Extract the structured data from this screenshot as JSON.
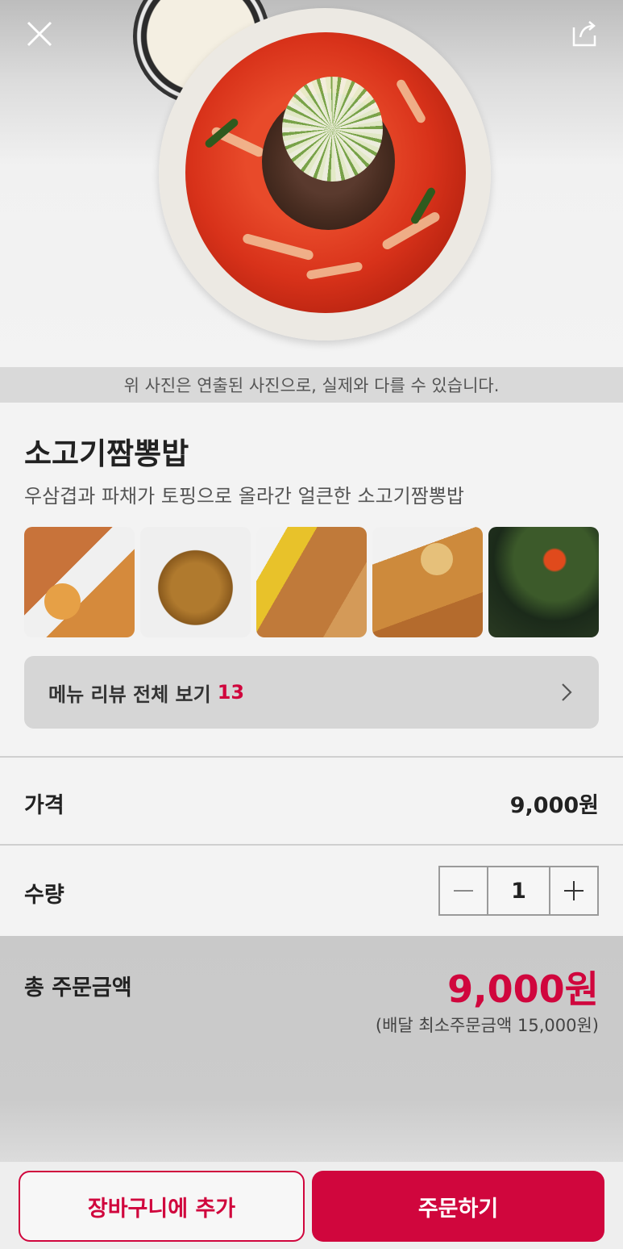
{
  "hero": {
    "image_icon": "food-photo",
    "close_icon": "close-icon",
    "share_icon": "share-icon",
    "disclaimer": "위 사진은 연출된 사진으로, 실제와 다를 수 있습니다."
  },
  "menu": {
    "title": "소고기짬뽕밥",
    "description": "우삼겹과 파채가 토핑으로 올라간 얼큰한 소고기짬뽕밥"
  },
  "review_photos": [
    "review-photo-1",
    "review-photo-2",
    "review-photo-3",
    "review-photo-4",
    "review-photo-5"
  ],
  "reviews": {
    "label": "메뉴 리뷰 전체 보기",
    "count": "13"
  },
  "price": {
    "label": "가격",
    "value": "9,000원"
  },
  "quantity": {
    "label": "수량",
    "value": "1"
  },
  "total": {
    "label": "총 주문금액",
    "value": "9,000원",
    "min_order_note": "(배달 최소주문금액 15,000원)"
  },
  "actions": {
    "add_to_cart": "장바구니에 추가",
    "order": "주문하기"
  },
  "colors": {
    "accent": "#d0063d"
  }
}
